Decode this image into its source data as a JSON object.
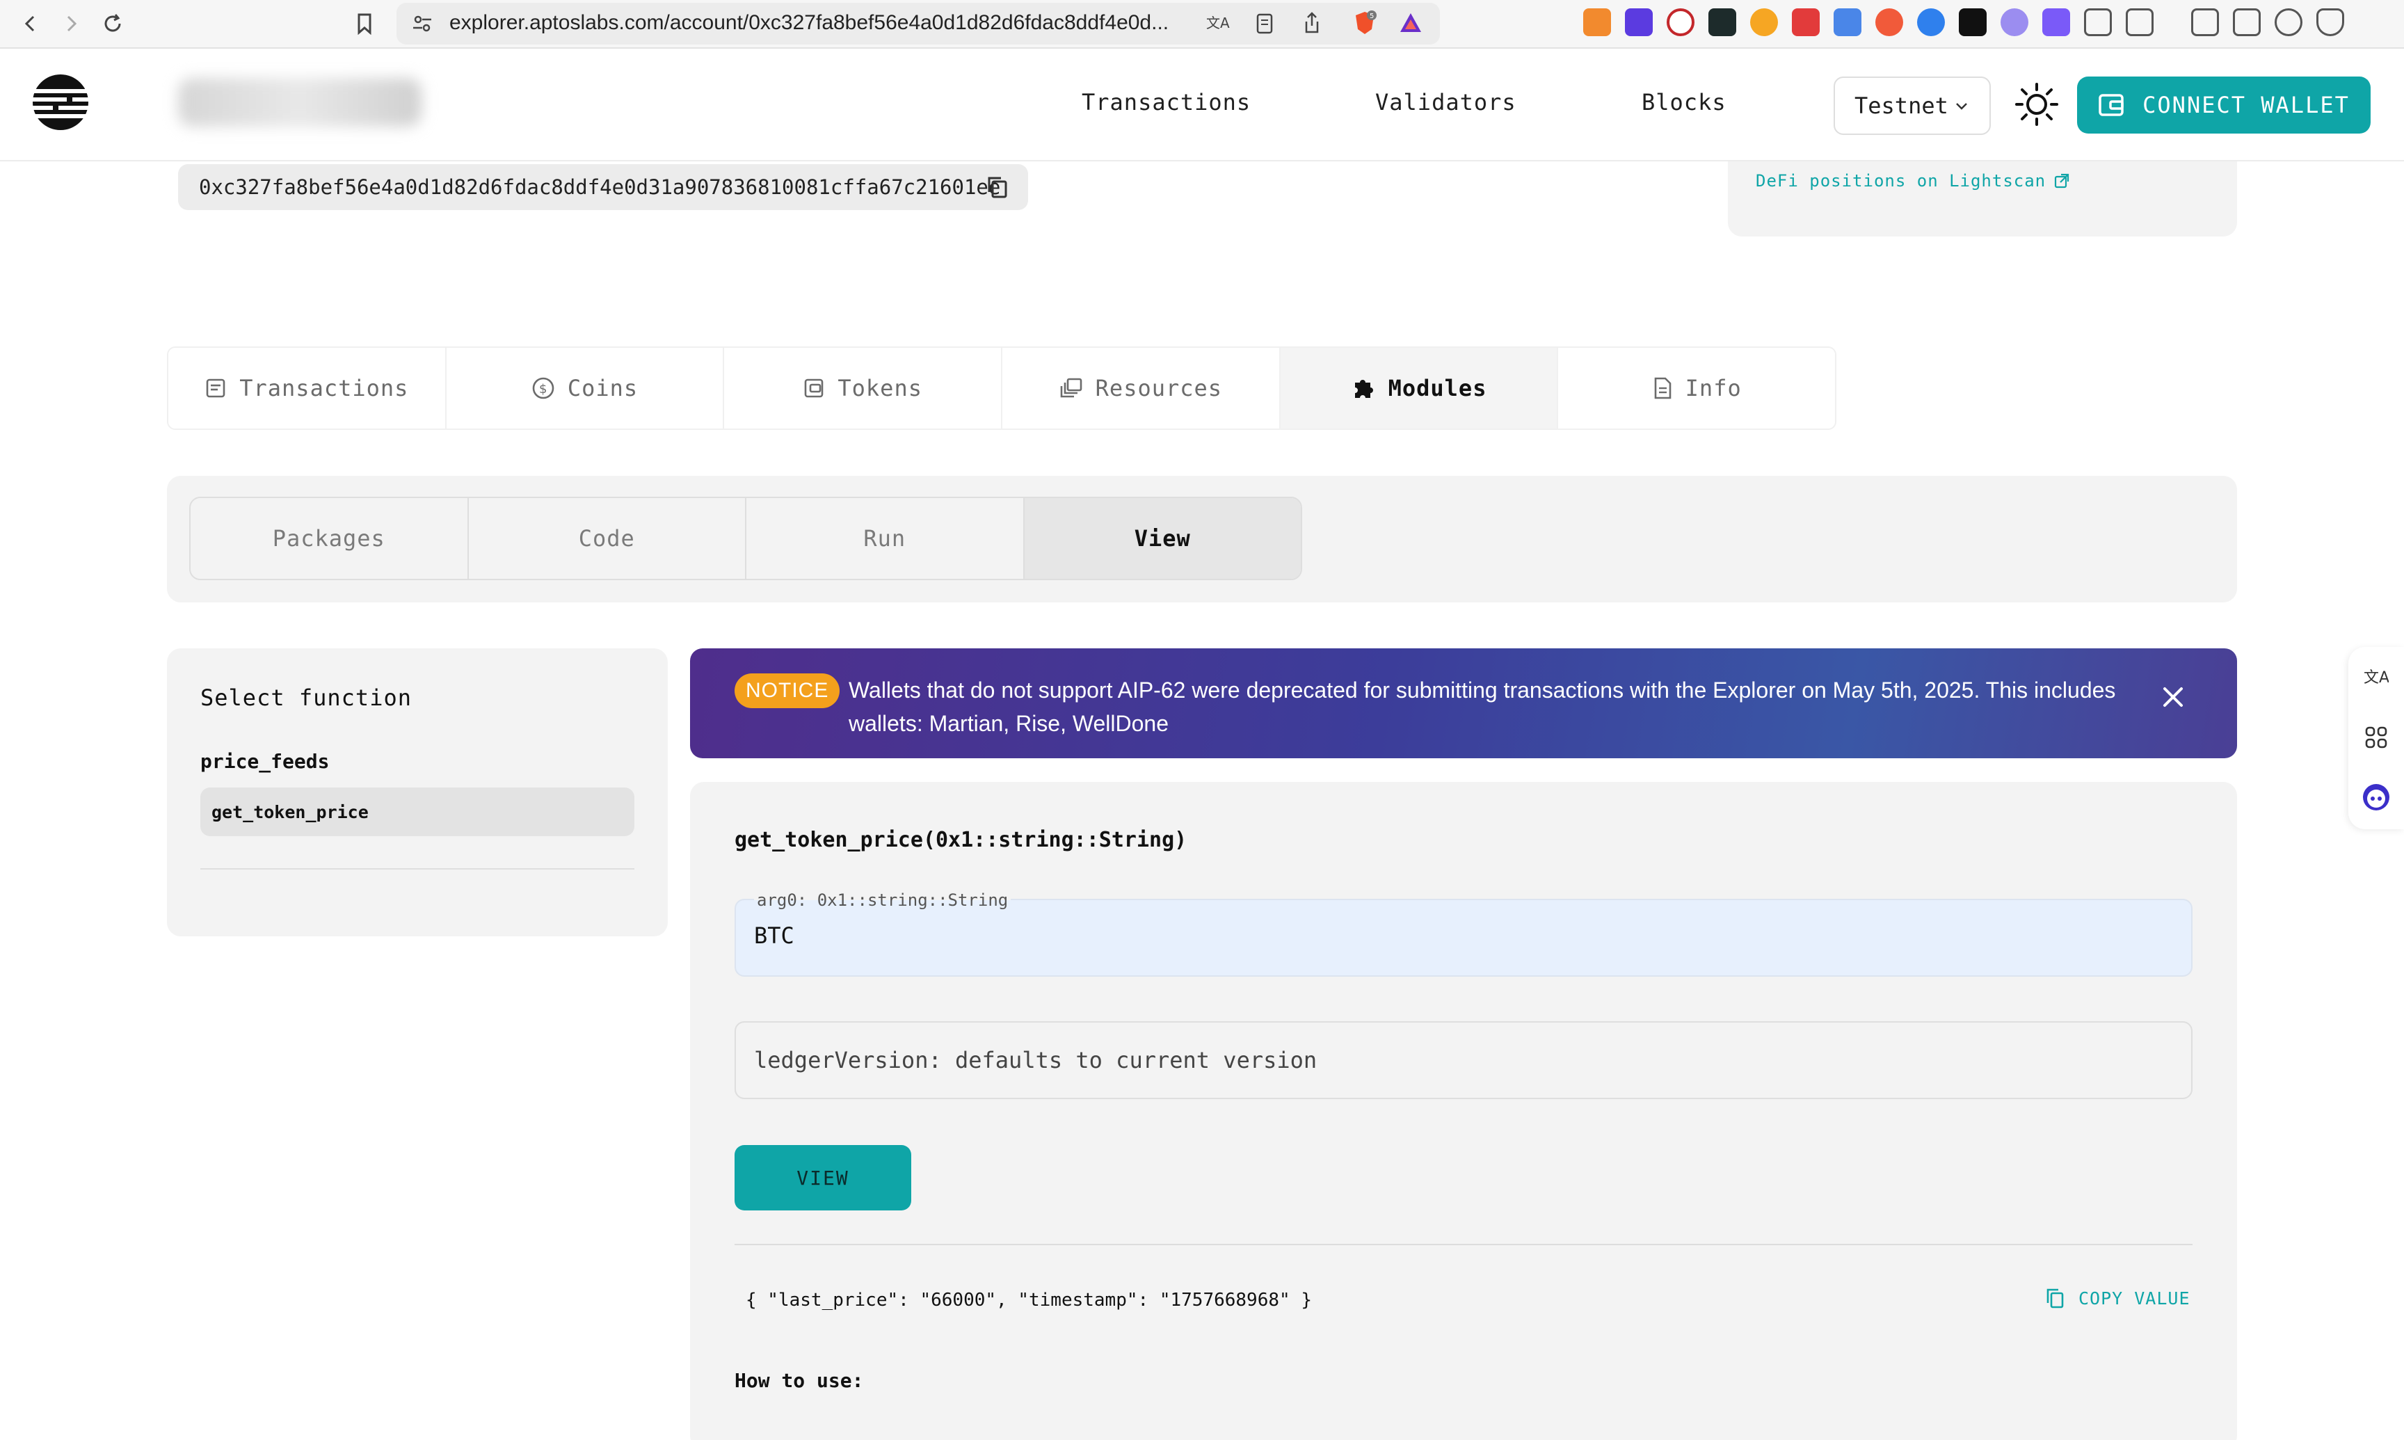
{
  "browser": {
    "url": "explorer.aptoslabs.com/account/0xc327fa8bef56e4a0d1d82d6fdac8ddf4e0d..."
  },
  "header": {
    "nav": [
      "Transactions",
      "Validators",
      "Blocks"
    ],
    "network": "Testnet",
    "connect_label": "CONNECT WALLET"
  },
  "account": {
    "address": "0xc327fa8bef56e4a0d1d82d6fdac8ddf4e0d31a907836810081cffa67c21601ee",
    "lightscan_link": "DeFi positions on Lightscan"
  },
  "tabs": [
    {
      "label": "Transactions",
      "icon": "receipt-icon"
    },
    {
      "label": "Coins",
      "icon": "coin-icon"
    },
    {
      "label": "Tokens",
      "icon": "token-icon"
    },
    {
      "label": "Resources",
      "icon": "resources-icon"
    },
    {
      "label": "Modules",
      "icon": "puzzle-icon"
    },
    {
      "label": "Info",
      "icon": "document-icon"
    }
  ],
  "active_tab": "Modules",
  "subtabs": [
    "Packages",
    "Code",
    "Run",
    "View"
  ],
  "active_subtab": "View",
  "function_panel": {
    "heading": "Select function",
    "module": "price_feeds",
    "selected_function": "get_token_price"
  },
  "notice": {
    "badge": "NOTICE",
    "message": "Wallets that do not support AIP-62 were deprecated for submitting transactions with the Explorer on May 5th, 2025. This includes wallets: Martian, Rise, WellDone"
  },
  "view": {
    "signature": "get_token_price(0x1::string::String)",
    "arg_label": "arg0: 0x1::string::String",
    "arg_value": "BTC",
    "ledger_placeholder": "ledgerVersion: defaults to current version",
    "view_button": "VIEW",
    "result": "{ \"last_price\": \"66000\", \"timestamp\": \"1757668968\" }",
    "copy_label": "COPY VALUE",
    "howto_heading": "How to use:"
  },
  "colors": {
    "accent": "#0fa5a7",
    "notice_badge": "#f4a01c",
    "notice_bg": "#3c3d9a"
  }
}
